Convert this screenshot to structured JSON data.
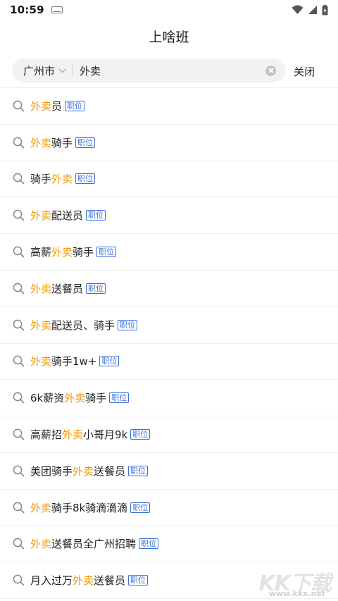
{
  "status_bar": {
    "time": "10:59"
  },
  "header": {
    "title": "上啥班"
  },
  "search": {
    "city": "广州市",
    "query": "外卖",
    "close_label": "关闭"
  },
  "suggestions": [
    {
      "parts": [
        {
          "t": "外卖",
          "hl": true
        },
        {
          "t": "员",
          "hl": false
        }
      ],
      "tag": "职位"
    },
    {
      "parts": [
        {
          "t": "外卖",
          "hl": true
        },
        {
          "t": "骑手",
          "hl": false
        }
      ],
      "tag": "职位"
    },
    {
      "parts": [
        {
          "t": "骑手",
          "hl": false
        },
        {
          "t": "外卖",
          "hl": true
        }
      ],
      "tag": "职位"
    },
    {
      "parts": [
        {
          "t": "外卖",
          "hl": true
        },
        {
          "t": "配送员",
          "hl": false
        }
      ],
      "tag": "职位"
    },
    {
      "parts": [
        {
          "t": "高薪",
          "hl": false
        },
        {
          "t": "外卖",
          "hl": true
        },
        {
          "t": "骑手",
          "hl": false
        }
      ],
      "tag": "职位"
    },
    {
      "parts": [
        {
          "t": "外卖",
          "hl": true
        },
        {
          "t": "送餐员",
          "hl": false
        }
      ],
      "tag": "职位"
    },
    {
      "parts": [
        {
          "t": "外卖",
          "hl": true
        },
        {
          "t": "配送员、骑手",
          "hl": false
        }
      ],
      "tag": "职位"
    },
    {
      "parts": [
        {
          "t": "外卖",
          "hl": true
        },
        {
          "t": "骑手1w+",
          "hl": false
        }
      ],
      "tag": "职位"
    },
    {
      "parts": [
        {
          "t": "6k薪资",
          "hl": false
        },
        {
          "t": "外卖",
          "hl": true
        },
        {
          "t": "骑手",
          "hl": false
        }
      ],
      "tag": "职位"
    },
    {
      "parts": [
        {
          "t": "高薪招",
          "hl": false
        },
        {
          "t": "外卖",
          "hl": true
        },
        {
          "t": "小哥月9k",
          "hl": false
        }
      ],
      "tag": "职位"
    },
    {
      "parts": [
        {
          "t": "美团骑手",
          "hl": false
        },
        {
          "t": "外卖",
          "hl": true
        },
        {
          "t": "送餐员",
          "hl": false
        }
      ],
      "tag": "职位"
    },
    {
      "parts": [
        {
          "t": "外卖",
          "hl": true
        },
        {
          "t": "骑手8k骑滴滴滴",
          "hl": false
        }
      ],
      "tag": "职位"
    },
    {
      "parts": [
        {
          "t": "外卖",
          "hl": true
        },
        {
          "t": "送餐员全广州招聘",
          "hl": false
        }
      ],
      "tag": "职位"
    },
    {
      "parts": [
        {
          "t": "月入过万",
          "hl": false
        },
        {
          "t": "外卖",
          "hl": true
        },
        {
          "t": "送餐员",
          "hl": false
        }
      ],
      "tag": "职位"
    }
  ],
  "watermark": {
    "logo": "KK下载",
    "site": "www.kkx.net"
  },
  "colors": {
    "highlight": "#f39800",
    "tag": "#3a6fd8"
  }
}
